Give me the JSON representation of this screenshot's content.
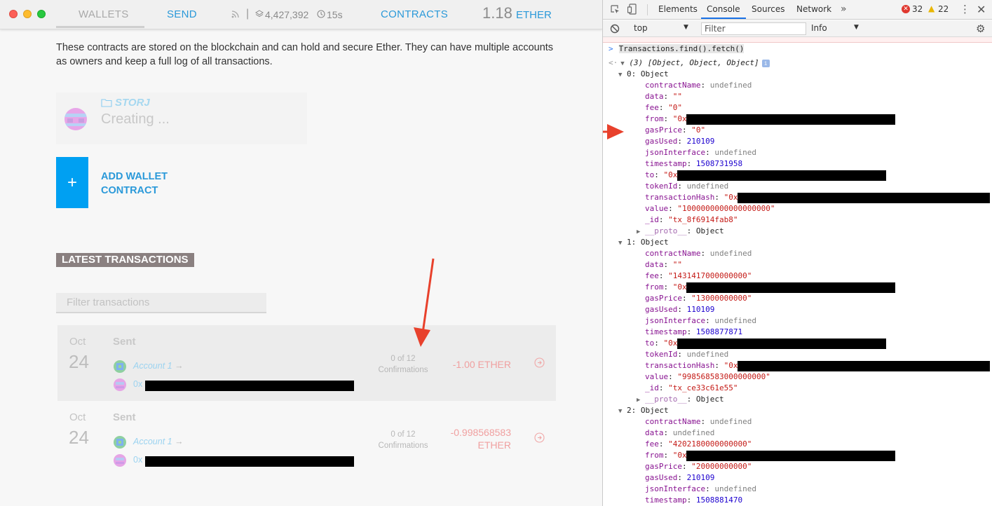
{
  "window": {
    "traffic_lights": [
      "close",
      "minimize",
      "zoom"
    ]
  },
  "nav": {
    "wallets": "WALLETS",
    "send": "SEND",
    "contracts": "CONTRACTS",
    "block_count": "4,427,392",
    "block_time": "15s",
    "balance": "1.18",
    "balance_unit": "ETHER",
    "separator": "|"
  },
  "intro": "These contracts are stored on the blockchain and can hold and secure Ether. They can have multiple accounts as owners and keep a full log of all transactions.",
  "contract": {
    "name": "STORJ",
    "status": "Creating ..."
  },
  "add_wallet": {
    "icon": "+",
    "label_line1": "ADD WALLET",
    "label_line2": "CONTRACT"
  },
  "latest": {
    "heading": "LATEST TRANSACTIONS",
    "filter_placeholder": "Filter transactions"
  },
  "transactions": [
    {
      "month": "Oct",
      "day": "24",
      "type": "Sent",
      "from": "Account 1",
      "to": "0x",
      "confirmations": "0 of 12",
      "confirmations_label": "Confirmations",
      "amount_line1": "-1.00 ETHER",
      "amount_line2": ""
    },
    {
      "month": "Oct",
      "day": "24",
      "type": "Sent",
      "from": "Account 1",
      "to": "0x",
      "confirmations": "0 of 12",
      "confirmations_label": "Confirmations",
      "amount_line1": "-0.998568583",
      "amount_line2": "ETHER"
    }
  ],
  "devtools": {
    "tabs": [
      "Elements",
      "Console",
      "Sources",
      "Network"
    ],
    "more": "»",
    "errors": "32",
    "warnings": "22",
    "context": "top",
    "filter_placeholder": "Filter",
    "level": "Info",
    "command": "Transactions.find().fetch()",
    "result_summary": "(3) [Object, Object, Object]",
    "info_badge": "i",
    "objects": [
      {
        "header": "0: Object",
        "fields": [
          {
            "key": "contractName",
            "value": "undefined",
            "kind": "u"
          },
          {
            "key": "data",
            "value": "\"\"",
            "kind": "s"
          },
          {
            "key": "fee",
            "value": "\"0\"",
            "kind": "s"
          },
          {
            "key": "from",
            "value": "\"0x",
            "kind": "s",
            "redacted": true
          },
          {
            "key": "gasPrice",
            "value": "\"0\"",
            "kind": "s"
          },
          {
            "key": "gasUsed",
            "value": "210109",
            "kind": "n"
          },
          {
            "key": "jsonInterface",
            "value": "undefined",
            "kind": "u"
          },
          {
            "key": "timestamp",
            "value": "1508731958",
            "kind": "n"
          },
          {
            "key": "to",
            "value": "\"0x",
            "kind": "s",
            "redacted": true
          },
          {
            "key": "tokenId",
            "value": "undefined",
            "kind": "u"
          },
          {
            "key": "transactionHash",
            "value": "\"0x",
            "kind": "s",
            "redacted": true
          },
          {
            "key": "value",
            "value": "\"1000000000000000000\"",
            "kind": "s"
          },
          {
            "key": "_id",
            "value": "\"tx_8f6914fab8\"",
            "kind": "s"
          },
          {
            "key": "__proto__",
            "value": "Object",
            "kind": "plain",
            "proto": true
          }
        ]
      },
      {
        "header": "1: Object",
        "fields": [
          {
            "key": "contractName",
            "value": "undefined",
            "kind": "u"
          },
          {
            "key": "data",
            "value": "\"\"",
            "kind": "s"
          },
          {
            "key": "fee",
            "value": "\"1431417000000000\"",
            "kind": "s"
          },
          {
            "key": "from",
            "value": "\"0x",
            "kind": "s",
            "redacted": true
          },
          {
            "key": "gasPrice",
            "value": "\"13000000000\"",
            "kind": "s"
          },
          {
            "key": "gasUsed",
            "value": "110109",
            "kind": "n"
          },
          {
            "key": "jsonInterface",
            "value": "undefined",
            "kind": "u"
          },
          {
            "key": "timestamp",
            "value": "1508877871",
            "kind": "n"
          },
          {
            "key": "to",
            "value": "\"0x",
            "kind": "s",
            "redacted": true
          },
          {
            "key": "tokenId",
            "value": "undefined",
            "kind": "u"
          },
          {
            "key": "transactionHash",
            "value": "\"0x",
            "kind": "s",
            "redacted": true
          },
          {
            "key": "value",
            "value": "\"998568583000000000\"",
            "kind": "s"
          },
          {
            "key": "_id",
            "value": "\"tx_ce33c61e55\"",
            "kind": "s"
          },
          {
            "key": "__proto__",
            "value": "Object",
            "kind": "plain",
            "proto": true
          }
        ]
      },
      {
        "header": "2: Object",
        "fields": [
          {
            "key": "contractName",
            "value": "undefined",
            "kind": "u"
          },
          {
            "key": "data",
            "value": "undefined",
            "kind": "u"
          },
          {
            "key": "fee",
            "value": "\"4202180000000000\"",
            "kind": "s"
          },
          {
            "key": "from",
            "value": "\"0x",
            "kind": "s",
            "redacted": true
          },
          {
            "key": "gasPrice",
            "value": "\"20000000000\"",
            "kind": "s"
          },
          {
            "key": "gasUsed",
            "value": "210109",
            "kind": "n"
          },
          {
            "key": "jsonInterface",
            "value": "undefined",
            "kind": "u"
          },
          {
            "key": "timestamp",
            "value": "1508881470",
            "kind": "n"
          }
        ]
      }
    ]
  },
  "colors": {
    "accent_blue": "#2a99d9",
    "add_button": "#00a0f2",
    "annotation_red": "#e8412c",
    "heading_bg": "#8a8080"
  }
}
